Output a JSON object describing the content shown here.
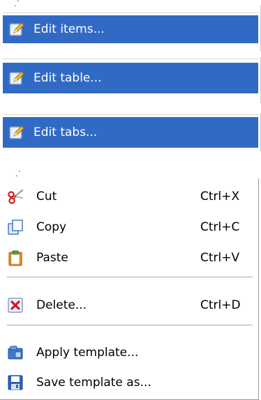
{
  "top_menus": [
    {
      "label": "Edit items..."
    },
    {
      "label": "Edit table..."
    },
    {
      "label": "Edit tabs..."
    }
  ],
  "context_menu": {
    "items": [
      {
        "label": "Cut",
        "shortcut": "Ctrl+X",
        "icon": "scissors-icon"
      },
      {
        "label": "Copy",
        "shortcut": "Ctrl+C",
        "icon": "copy-icon"
      },
      {
        "label": "Paste",
        "shortcut": "Ctrl+V",
        "icon": "paste-icon"
      },
      {
        "label": "Delete...",
        "shortcut": "Ctrl+D",
        "icon": "delete-icon"
      },
      {
        "label": "Apply template...",
        "shortcut": "",
        "icon": "apply-template-icon"
      },
      {
        "label": "Save template as...",
        "shortcut": "",
        "icon": "save-icon"
      }
    ]
  },
  "colors": {
    "selection": "#316ac5",
    "selection_text": "#ffffff"
  }
}
